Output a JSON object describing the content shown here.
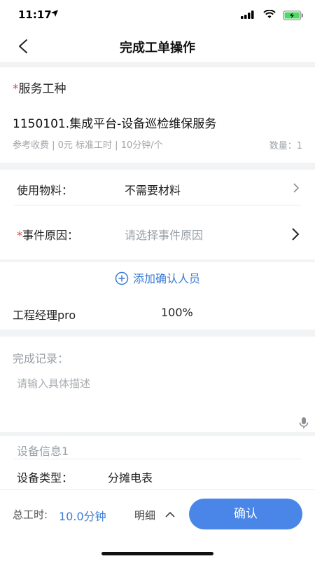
{
  "status_bar": {
    "time": "11:17"
  },
  "nav": {
    "title": "完成工单操作"
  },
  "service": {
    "label": "服务工种",
    "name": "1150101.集成平台-设备巡检维保服务",
    "meta": "参考收费 | 0元 标准工时 | 10分钟/个",
    "qty": "数量：1"
  },
  "materials": {
    "label": "使用物料：",
    "value": "不需要材料"
  },
  "cause": {
    "label": "事件原因：",
    "placeholder": "请选择事件原因"
  },
  "confirmers": {
    "add_label": "添加确认人员",
    "person": "工程经理pro",
    "percent": "100%"
  },
  "record": {
    "label": "完成记录：",
    "placeholder": "请输入具体描述"
  },
  "device": {
    "title": "设备信息1",
    "type_label": "设备类型：",
    "type_value": "分摊电表"
  },
  "footer": {
    "time_label": "总工时:",
    "time_value": "10.0分钟",
    "detail_label": "明细",
    "confirm_label": "确认"
  },
  "colors": {
    "accent": "#4a86e8",
    "required": "#e64340"
  }
}
